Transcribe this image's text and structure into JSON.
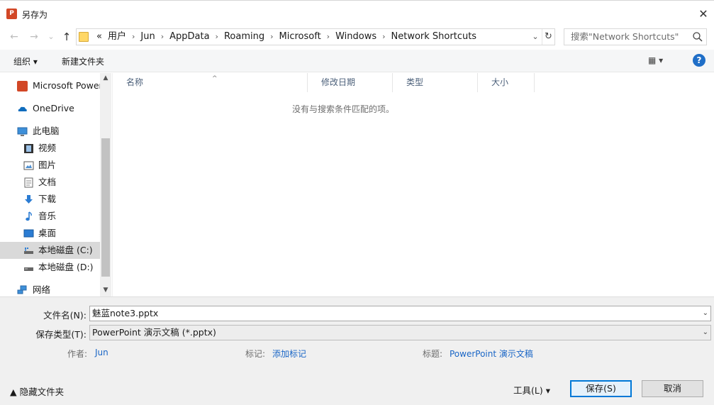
{
  "window": {
    "title": "另存为",
    "close_glyph": "✕",
    "app_icon": "P"
  },
  "nav": {
    "back": "←",
    "forward": "→",
    "recent": "⌄",
    "up": "↑"
  },
  "address": {
    "overflow": "«",
    "crumbs": [
      "用户",
      "Jun",
      "AppData",
      "Roaming",
      "Microsoft",
      "Windows",
      "Network Shortcuts"
    ],
    "separator": "›",
    "dropdown": "⌄",
    "refresh": "↻"
  },
  "search": {
    "placeholder": "搜索\"Network Shortcuts\""
  },
  "toolbar": {
    "organize": "组织 ▾",
    "new_folder": "新建文件夹",
    "view": "▦ ▾",
    "help": "?"
  },
  "sidebar": {
    "items": [
      {
        "label": "Microsoft Power",
        "icon": "powerpoint-icon"
      },
      {
        "label": "OneDrive",
        "icon": "onedrive-icon"
      },
      {
        "label": "此电脑",
        "icon": "computer-icon"
      },
      {
        "label": "视频",
        "icon": "video-icon"
      },
      {
        "label": "图片",
        "icon": "pictures-icon"
      },
      {
        "label": "文档",
        "icon": "documents-icon"
      },
      {
        "label": "下载",
        "icon": "download-icon"
      },
      {
        "label": "音乐",
        "icon": "music-icon"
      },
      {
        "label": "桌面",
        "icon": "desktop-icon"
      },
      {
        "label": "本地磁盘 (C:)",
        "icon": "drive-c-icon",
        "selected": true
      },
      {
        "label": "本地磁盘 (D:)",
        "icon": "drive-d-icon"
      },
      {
        "label": "网络",
        "icon": "network-icon"
      }
    ],
    "scroll_up": "▲",
    "scroll_down": "▼"
  },
  "filelist": {
    "columns": [
      "名称",
      "修改日期",
      "类型",
      "大小"
    ],
    "sort_arrow": "^",
    "empty_message": "没有与搜索条件匹配的项。"
  },
  "form": {
    "filename_label": "文件名(N):",
    "filename_value": "魅蓝note3.pptx",
    "filetype_label": "保存类型(T):",
    "filetype_value": "PowerPoint 演示文稿 (*.pptx)",
    "dropdown_glyph": "⌄",
    "author_label": "作者:",
    "author_value": "Jun",
    "tags_label": "标记:",
    "tags_value": "添加标记",
    "title_label": "标题:",
    "title_value": "PowerPoint 演示文稿"
  },
  "footer": {
    "hide_folders": "▲ 隐藏文件夹",
    "tools": "工具(L)  ▾",
    "save": "保存(S)",
    "cancel": "取消"
  },
  "colors": {
    "accent": "#0078d7",
    "link": "#1a66c6",
    "powerpoint": "#d24726"
  }
}
